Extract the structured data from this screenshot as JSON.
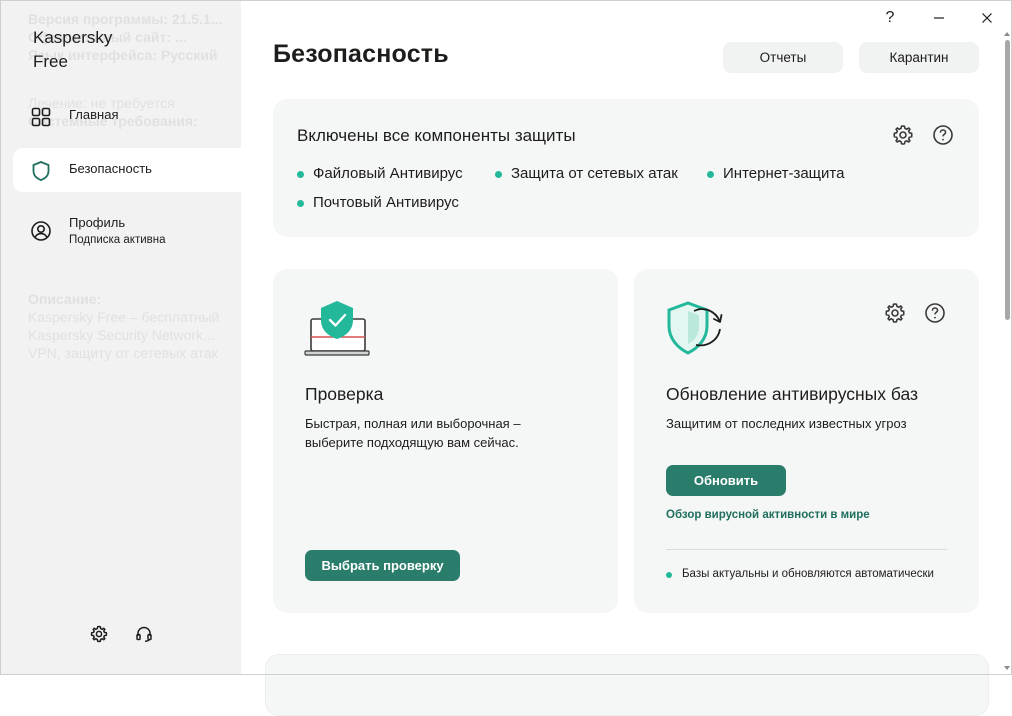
{
  "app": {
    "title_line1": "Kaspersky",
    "title_line2": "Free"
  },
  "window_controls": {
    "help": "?",
    "minimize": "minimize",
    "close": "close"
  },
  "sidebar": {
    "items": [
      {
        "label": "Главная",
        "icon": "home-grid-icon"
      },
      {
        "label": "Безопасность",
        "icon": "shield-icon",
        "active": true
      },
      {
        "label": "Профиль",
        "sublabel": "Подписка активна",
        "icon": "user-icon"
      }
    ],
    "bottom_icons": [
      "gear-icon",
      "headset-icon"
    ]
  },
  "header": {
    "title": "Безопасность",
    "reports_label": "Отчеты",
    "quarantine_label": "Карантин"
  },
  "protection": {
    "title": "Включены все компоненты защиты",
    "components": [
      "Файловый Антивирус",
      "Защита от сетевых атак",
      "Интернет-защита",
      "Почтовый Антивирус"
    ]
  },
  "scan": {
    "title": "Проверка",
    "description_line1": "Быстрая, полная или выборочная –",
    "description_line2": "выберите подходящую вам сейчас.",
    "button_label": "Выбрать проверку"
  },
  "update": {
    "title": "Обновление антивирусных баз",
    "description": "Защитим от последних известных угроз",
    "button_label": "Обновить",
    "link_label": "Обзор вирусной активности в мире",
    "status": "Базы актуальны и обновляются автоматически"
  },
  "colors": {
    "accent": "#2a7c6b",
    "status_dot": "#23b89a",
    "card_bg": "#f5f7f6",
    "sidebar_bg": "#f2f2f2"
  }
}
